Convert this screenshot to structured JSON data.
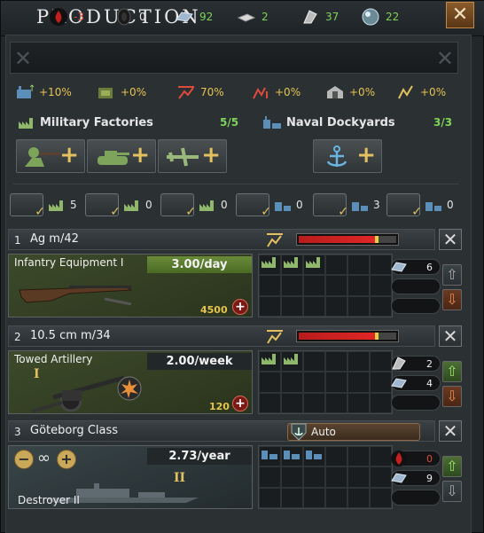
{
  "title": "Production",
  "colors": {
    "positive": "#7fd35a",
    "negative": "#e04a3a",
    "gold": "#e6c450",
    "panel": "#2b3033"
  },
  "resources": [
    {
      "icon": "oil-icon",
      "value": "-3",
      "color": "#e04a3a"
    },
    {
      "icon": "rubber-icon",
      "value": "0",
      "color": "#f0f0f0"
    },
    {
      "icon": "steel-icon",
      "value": "92",
      "color": "#7fd35a"
    },
    {
      "icon": "aluminium-icon",
      "value": "2",
      "color": "#7fd35a"
    },
    {
      "icon": "tungsten-icon",
      "value": "37",
      "color": "#7fd35a"
    },
    {
      "icon": "chromium-icon",
      "value": "22",
      "color": "#7fd35a"
    }
  ],
  "modifiers": [
    {
      "icon": "factory-output-icon",
      "value": "+10%"
    },
    {
      "icon": "construction-speed-icon",
      "value": "+0%"
    },
    {
      "icon": "production-efficiency-cap-icon",
      "value": "70%"
    },
    {
      "icon": "efficiency-growth-icon",
      "value": "+0%"
    },
    {
      "icon": "resource-gain-icon",
      "value": "+0%"
    },
    {
      "icon": "efficiency-retention-icon",
      "value": "+0%"
    }
  ],
  "military": {
    "label": "Military Factories",
    "count": "5/5"
  },
  "naval": {
    "label": "Naval Dockyards",
    "count": "3/3"
  },
  "filters": [
    {
      "icon": "infantry-equipment-filter-icon",
      "value": "5"
    },
    {
      "icon": "armor-filter-icon",
      "value": "0"
    },
    {
      "icon": "air-filter-icon",
      "value": "0"
    },
    {
      "icon": "special-filter-icon",
      "value": "0"
    },
    {
      "icon": "naval-filter-icon",
      "value": "3"
    },
    {
      "icon": "naval-convoy-filter-icon",
      "value": "0"
    }
  ],
  "lines": [
    {
      "num": "1",
      "name": "Ag m/42",
      "type": "Infantry Equipment I",
      "rate": "3.00/day",
      "cost": "4500",
      "efficiency": 0.78,
      "factories": 3,
      "res": [
        {
          "icon": "steel-icon",
          "value": "6"
        }
      ]
    },
    {
      "num": "2",
      "name": "10.5 cm m/34",
      "type": "Towed Artillery",
      "rate": "2.00/week",
      "cost": "120",
      "efficiency": 0.78,
      "factories": 2,
      "res": [
        {
          "icon": "tungsten-icon",
          "value": "2"
        },
        {
          "icon": "steel-icon",
          "value": "4"
        }
      ]
    },
    {
      "num": "3",
      "name": "Göteborg Class",
      "type": "Destroyer II",
      "rate": "2.73/year",
      "auto": "Auto",
      "factories": 3,
      "res": [
        {
          "icon": "oil-icon",
          "value": "0",
          "color": "#e04a3a"
        },
        {
          "icon": "steel-icon",
          "value": "9"
        }
      ]
    }
  ]
}
